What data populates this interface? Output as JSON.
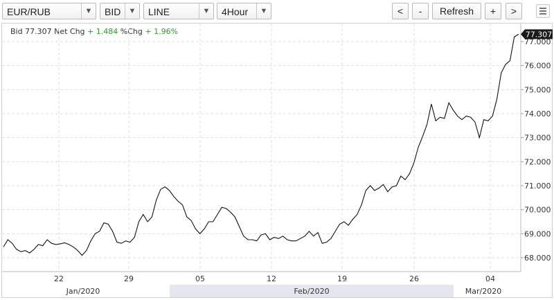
{
  "toolbar": {
    "symbol": "EUR/RUB",
    "price_type": "BID",
    "chart_style": "LINE",
    "interval": "4Hour",
    "prev_label": "<",
    "zoom_out_label": "-",
    "refresh_label": "Refresh",
    "zoom_in_label": "+",
    "next_label": ">",
    "dropdown_glyph": "▼"
  },
  "quote": {
    "bid_label": "Bid",
    "bid_value": "77.307",
    "net_chg_label": "Net Chg",
    "net_chg_value": "+ 1.484",
    "pct_chg_label": "%Chg",
    "pct_chg_value": "+ 1.96%"
  },
  "colors": {
    "line": "#111111",
    "positive": "#2e9a2e",
    "grid": "#dddddd",
    "bottom_band": "#e3e6ee"
  },
  "chart_data": {
    "type": "line",
    "title": "",
    "last_price_label": "77.307",
    "ylim": [
      67.6,
      77.6
    ],
    "y_ticks": [
      "68.000",
      "69.000",
      "70.000",
      "71.000",
      "72.000",
      "73.000",
      "74.000",
      "75.000",
      "76.000",
      "77.000"
    ],
    "x_ticks": [
      "22",
      "29",
      "05",
      "12",
      "19",
      "26",
      "04"
    ],
    "month_labels": [
      "Jan/2020",
      "Feb/2020",
      "Mar/2020"
    ],
    "grid": true,
    "values": [
      68.45,
      68.75,
      68.6,
      68.35,
      68.25,
      68.3,
      68.2,
      68.35,
      68.55,
      68.5,
      68.75,
      68.6,
      68.55,
      68.58,
      68.62,
      68.55,
      68.45,
      68.3,
      68.1,
      68.3,
      68.7,
      69.0,
      69.1,
      69.45,
      69.4,
      69.1,
      68.65,
      68.6,
      68.7,
      68.65,
      68.85,
      69.5,
      69.8,
      69.5,
      69.7,
      70.4,
      70.85,
      70.95,
      70.8,
      70.55,
      70.35,
      70.2,
      69.7,
      69.55,
      69.2,
      69.0,
      69.2,
      69.5,
      69.5,
      69.8,
      70.1,
      70.05,
      69.9,
      69.7,
      69.3,
      68.9,
      68.75,
      68.75,
      68.7,
      68.95,
      69.0,
      68.75,
      68.85,
      68.8,
      68.9,
      68.75,
      68.7,
      68.7,
      68.8,
      68.9,
      69.1,
      68.9,
      69.05,
      68.6,
      68.65,
      68.8,
      69.1,
      69.4,
      69.5,
      69.35,
      69.6,
      69.8,
      70.2,
      70.8,
      71.0,
      70.8,
      70.9,
      71.05,
      70.75,
      70.95,
      71.0,
      71.4,
      71.25,
      71.5,
      71.95,
      72.6,
      73.05,
      73.55,
      74.4,
      73.7,
      73.85,
      73.8,
      74.45,
      74.15,
      73.9,
      73.75,
      73.9,
      73.85,
      73.65,
      73.0,
      73.75,
      73.7,
      73.9,
      74.6,
      75.7,
      76.05,
      76.2,
      77.2,
      77.307
    ]
  }
}
